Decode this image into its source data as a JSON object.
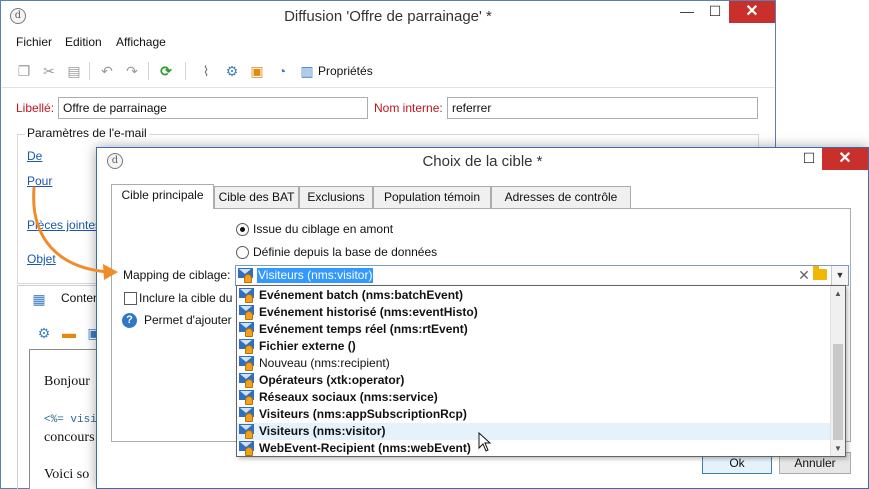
{
  "main_window": {
    "title": "Diffusion 'Offre de parrainage' *",
    "app_icon_glyph": "d",
    "controls": {
      "minimize": "—",
      "maximize": "☐",
      "close": "✕"
    },
    "menu": [
      "Fichier",
      "Edition",
      "Affichage"
    ],
    "toolbar": {
      "properties_label": "Propriétés"
    },
    "form": {
      "libelle_label": "Libellé:",
      "libelle_value": "Offre de parrainage",
      "nom_interne_label": "Nom interne:",
      "nom_interne_value": "referrer"
    },
    "email_params": {
      "title": "Paramètres de l'e-mail",
      "links": [
        "De",
        "Pour",
        "Pièces jointes",
        "Objet"
      ]
    },
    "content": {
      "tab_label": "Contenu",
      "editor_lines": [
        "Bonjour",
        "<%= visi",
        "concours",
        "Voici so"
      ]
    }
  },
  "dialog": {
    "title": "Choix de la cible *",
    "tabs": [
      "Cible principale",
      "Cible des BAT",
      "Exclusions",
      "Population témoin",
      "Adresses de contrôle"
    ],
    "active_tab": "Cible principale",
    "radio_options": [
      "Issue du ciblage en amont",
      "Définie depuis la base de données"
    ],
    "selected_radio": "Issue du ciblage en amont",
    "mapping_label": "Mapping de ciblage:",
    "mapping_value": "Visiteurs (nms:visitor)",
    "include_checkbox_label": "Inclure la cible du",
    "help_text": "Permet d'ajouter",
    "dropdown_items": [
      {
        "label": "Evénement batch (nms:batchEvent)",
        "bold": true
      },
      {
        "label": "Evénement historisé (nms:eventHisto)",
        "bold": true
      },
      {
        "label": "Evénement temps réel (nms:rtEvent)",
        "bold": true
      },
      {
        "label": "Fichier externe ()",
        "bold": true
      },
      {
        "label": "Nouveau (nms:recipient)",
        "bold": false
      },
      {
        "label": "Opérateurs (xtk:operator)",
        "bold": true
      },
      {
        "label": "Réseaux sociaux (nms:service)",
        "bold": true
      },
      {
        "label": "Visiteurs (nms:appSubscriptionRcp)",
        "bold": true
      },
      {
        "label": "Visiteurs (nms:visitor)",
        "bold": true,
        "highlighted": true
      },
      {
        "label": "WebEvent-Recipient (nms:webEvent)",
        "bold": true
      }
    ],
    "buttons": {
      "ok": "Ok",
      "cancel": "Annuler"
    }
  },
  "colors": {
    "window_border": "#3b6ea8",
    "close_button": "#c9302c",
    "label_red": "#c0141c",
    "link_blue": "#1a57b0",
    "selection_blue": "#3399ff",
    "arrow_orange": "#f08c2a"
  }
}
